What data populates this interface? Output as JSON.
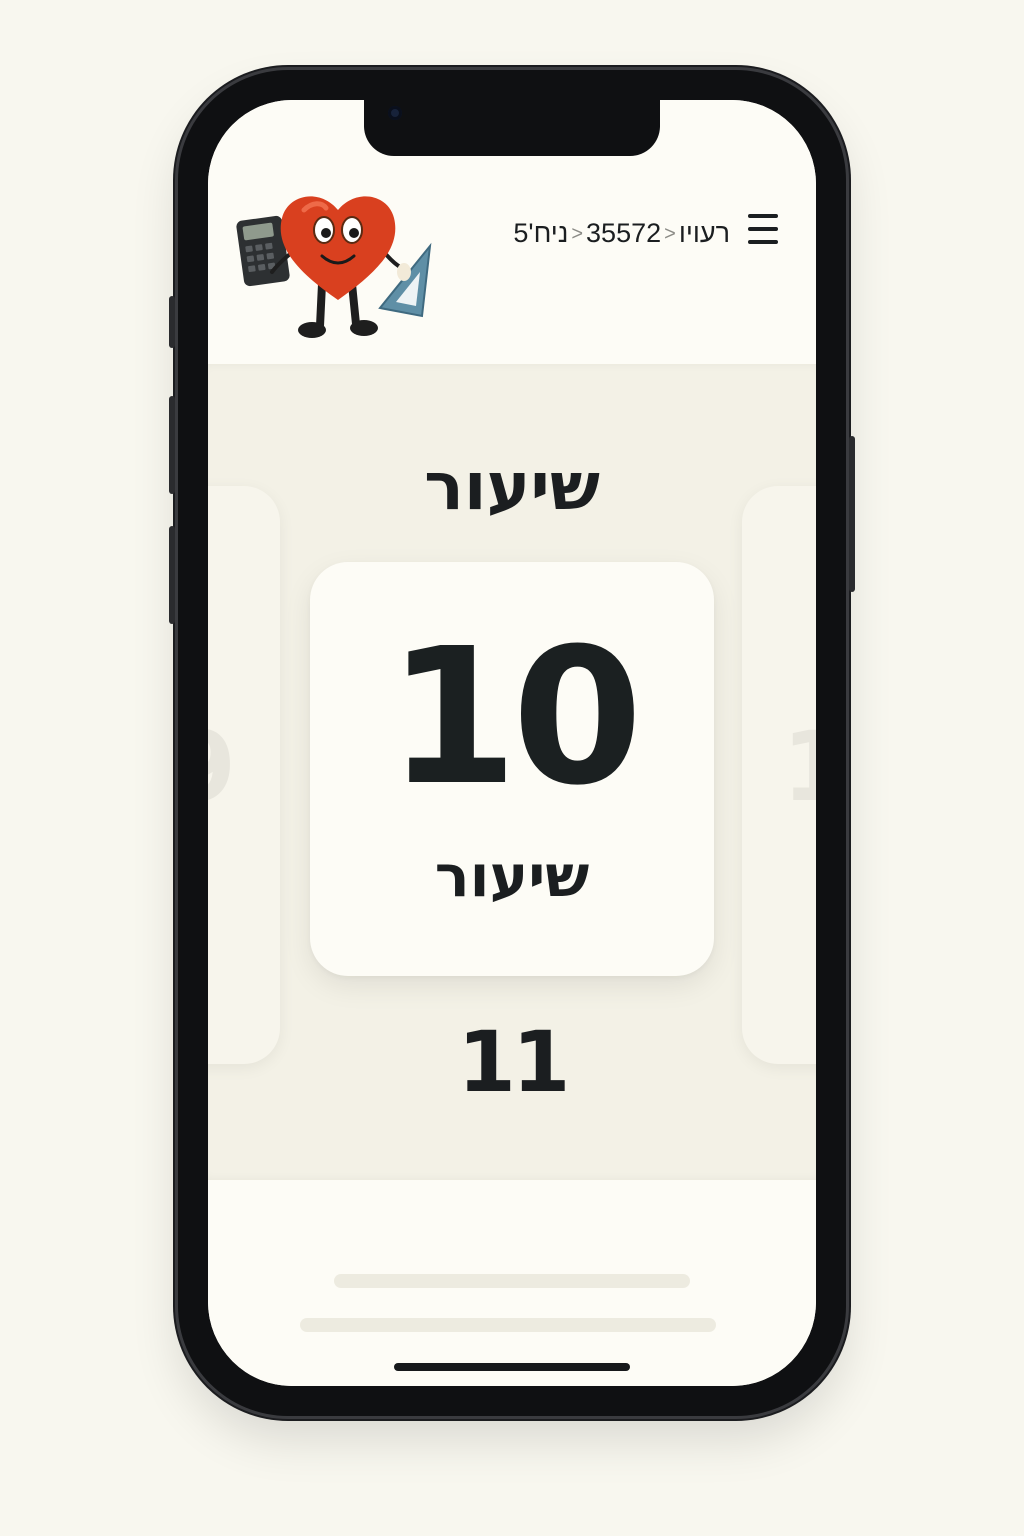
{
  "header": {
    "breadcrumb": [
      "רעויו",
      "35572",
      "ניח'5"
    ],
    "breadcrumb_separator": "<",
    "menu_icon": "hamburger-menu-icon",
    "mascot": "heart-mascot-with-calculator-and-ruler"
  },
  "main": {
    "section_title": "שיעור",
    "selected": {
      "number": "10",
      "label": "שיעור"
    },
    "next_number": "11"
  },
  "colors": {
    "page_background": "#f8f7ef",
    "screen_background": "#fdfcf6",
    "main_background": "#f3f1e6",
    "text": "#1b1e20",
    "mascot_heart": "#d9401f",
    "ruler": "#5f8fa6"
  }
}
